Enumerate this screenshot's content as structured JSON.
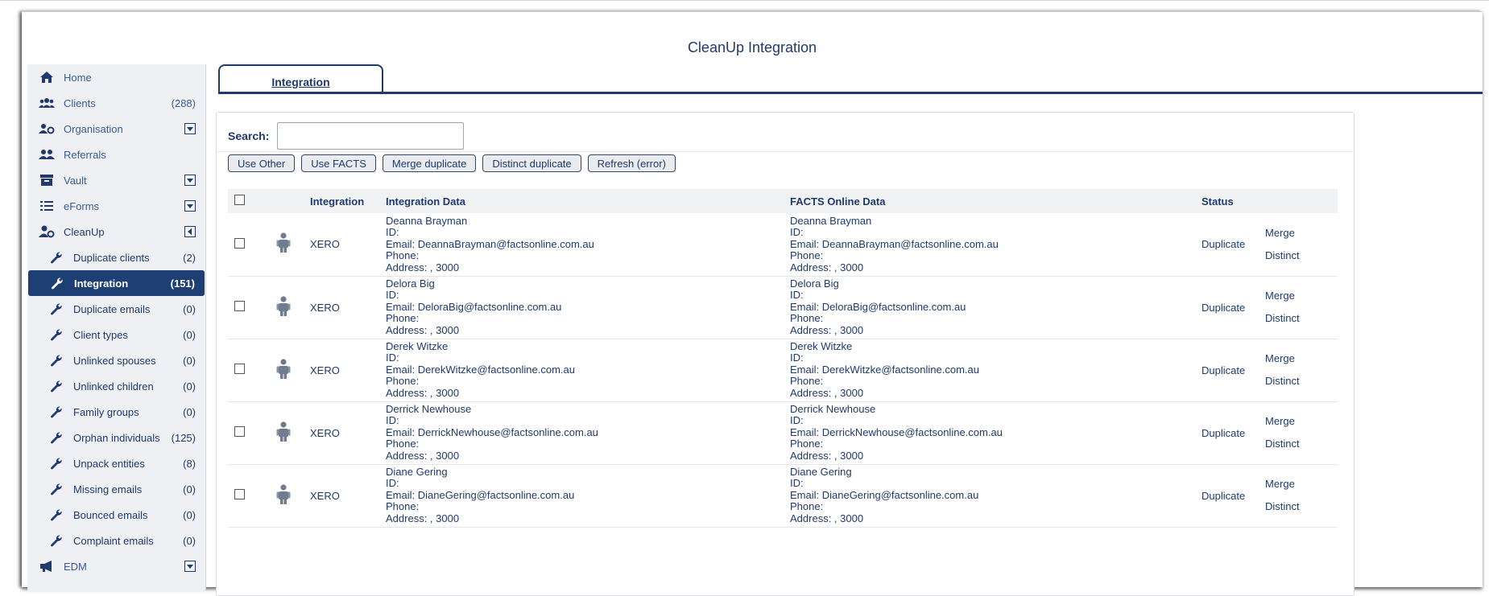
{
  "page_title": "CleanUp Integration",
  "sidebar": {
    "items": [
      {
        "label": "Home",
        "count": "",
        "toggle": false,
        "icon": "home-icon"
      },
      {
        "label": "Clients",
        "count": "(288)",
        "toggle": false,
        "icon": "users-icon"
      },
      {
        "label": "Organisation",
        "count": "",
        "toggle": true,
        "icon": "organisation-icon"
      },
      {
        "label": "Referrals",
        "count": "",
        "toggle": false,
        "icon": "referrals-icon"
      },
      {
        "label": "Vault",
        "count": "",
        "toggle": true,
        "icon": "vault-icon"
      },
      {
        "label": "eForms",
        "count": "",
        "toggle": true,
        "icon": "list-icon"
      },
      {
        "label": "CleanUp",
        "count": "",
        "toggle": true,
        "icon": "user-cog-icon"
      }
    ],
    "cleanup_items": [
      {
        "label": "Duplicate clients",
        "count": "(2)"
      },
      {
        "label": "Integration",
        "count": "(151)"
      },
      {
        "label": "Duplicate emails",
        "count": "(0)"
      },
      {
        "label": "Client types",
        "count": "(0)"
      },
      {
        "label": "Unlinked spouses",
        "count": "(0)"
      },
      {
        "label": "Unlinked children",
        "count": "(0)"
      },
      {
        "label": "Family groups",
        "count": "(0)"
      },
      {
        "label": "Orphan individuals",
        "count": "(125)"
      },
      {
        "label": "Unpack entities",
        "count": "(8)"
      },
      {
        "label": "Missing emails",
        "count": "(0)"
      },
      {
        "label": "Bounced emails",
        "count": "(0)"
      },
      {
        "label": "Complaint emails",
        "count": "(0)"
      }
    ],
    "last_item": {
      "label": "EDM",
      "icon": "megaphone-icon"
    }
  },
  "tab": {
    "label": "Integration"
  },
  "search": {
    "label": "Search:",
    "value": ""
  },
  "buttons": [
    "Use Other",
    "Use FACTS",
    "Merge duplicate",
    "Distinct duplicate",
    "Refresh (error)"
  ],
  "table": {
    "headers": {
      "integration": "Integration",
      "integration_data": "Integration Data",
      "facts_data": "FACTS Online Data",
      "status": "Status"
    },
    "rows": [
      {
        "integration": "XERO",
        "name": "Deanna Brayman",
        "id": "ID:",
        "email": "Email: DeannaBrayman@factsonline.com.au",
        "phone": "Phone:",
        "address": "Address: , 3000",
        "status": "Duplicate",
        "merge": "Merge",
        "distinct": "Distinct"
      },
      {
        "integration": "XERO",
        "name": "Delora Big",
        "id": "ID:",
        "email": "Email: DeloraBig@factsonline.com.au",
        "phone": "Phone:",
        "address": "Address: , 3000",
        "status": "Duplicate",
        "merge": "Merge",
        "distinct": "Distinct"
      },
      {
        "integration": "XERO",
        "name": "Derek Witzke",
        "id": "ID:",
        "email": "Email: DerekWitzke@factsonline.com.au",
        "phone": "Phone:",
        "address": "Address: , 3000",
        "status": "Duplicate",
        "merge": "Merge",
        "distinct": "Distinct"
      },
      {
        "integration": "XERO",
        "name": "Derrick Newhouse",
        "id": "ID:",
        "email": "Email: DerrickNewhouse@factsonline.com.au",
        "phone": "Phone:",
        "address": "Address: , 3000",
        "status": "Duplicate",
        "merge": "Merge",
        "distinct": "Distinct"
      },
      {
        "integration": "XERO",
        "name": "Diane Gering",
        "id": "ID:",
        "email": "Email: DianeGering@factsonline.com.au",
        "phone": "Phone:",
        "address": "Address: , 3000",
        "status": "Duplicate",
        "merge": "Merge",
        "distinct": "Distinct"
      }
    ]
  }
}
